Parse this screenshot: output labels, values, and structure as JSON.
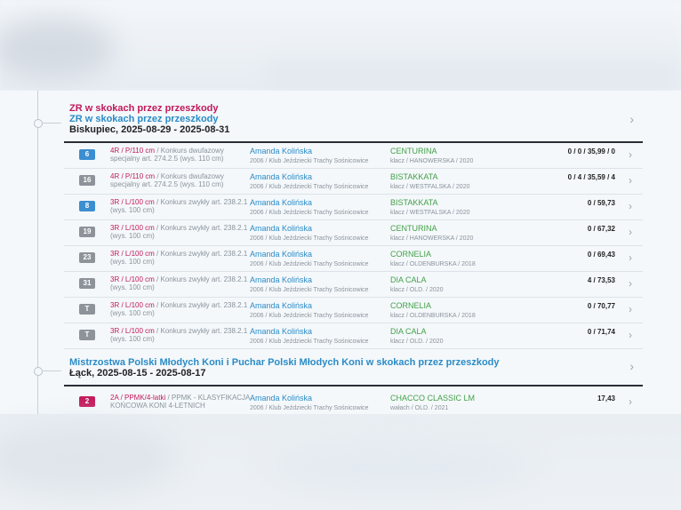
{
  "events": [
    {
      "title_primary": "ZR w skokach przez przeszkody",
      "title_secondary": "ZR w skokach przez przeszkody",
      "place_dates": "Biskupiec, 2025-08-29 - 2025-08-31",
      "rows": [
        {
          "badge": "6",
          "badge_color": "blue",
          "class": "4R / P/110 cm",
          "comp": " / Konkurs dwufazowy specjalny art. 274.2.5 (wys. 110 cm)",
          "rider": "Amanda Kolińska",
          "rider_sub": "2006 / Klub Jeździecki Trachy Sośnicowice",
          "horse": "CENTURINA",
          "horse_sub": "klacz / HANOWERSKA / 2020",
          "score": "0 / 0 / 35,99 / 0"
        },
        {
          "badge": "16",
          "badge_color": "grey",
          "class": "4R / P/110 cm",
          "comp": " / Konkurs dwufazowy specjalny art. 274.2.5 (wys. 110 cm)",
          "rider": "Amanda Kolińska",
          "rider_sub": "2006 / Klub Jeździecki Trachy Sośnicowice",
          "horse": "BISTAKKATA",
          "horse_sub": "klacz / WESTFALSKA / 2020",
          "score": "0 / 4 / 35,59 / 4"
        },
        {
          "badge": "8",
          "badge_color": "blue",
          "class": "3R / L/100 cm",
          "comp": " / Konkurs zwykły art. 238.2.1 (wys. 100 cm)",
          "rider": "Amanda Kolińska",
          "rider_sub": "2006 / Klub Jeździecki Trachy Sośnicowice",
          "horse": "BISTAKKATA",
          "horse_sub": "klacz / WESTFALSKA / 2020",
          "score": "0 / 59,73"
        },
        {
          "badge": "19",
          "badge_color": "grey",
          "class": "3R / L/100 cm",
          "comp": " / Konkurs zwykły art. 238.2.1 (wys. 100 cm)",
          "rider": "Amanda Kolińska",
          "rider_sub": "2006 / Klub Jeździecki Trachy Sośnicowice",
          "horse": "CENTURINA",
          "horse_sub": "klacz / HANOWERSKA / 2020",
          "score": "0 / 67,32"
        },
        {
          "badge": "23",
          "badge_color": "grey",
          "class": "3R / L/100 cm",
          "comp": " / Konkurs zwykły art. 238.2.1 (wys. 100 cm)",
          "rider": "Amanda Kolińska",
          "rider_sub": "2006 / Klub Jeździecki Trachy Sośnicowice",
          "horse": "CORNELIA",
          "horse_sub": "klacz / OLDENBURSKA / 2018",
          "score": "0 / 69,43"
        },
        {
          "badge": "31",
          "badge_color": "grey",
          "class": "3R / L/100 cm",
          "comp": " / Konkurs zwykły art. 238.2.1 (wys. 100 cm)",
          "rider": "Amanda Kolińska",
          "rider_sub": "2006 / Klub Jeździecki Trachy Sośnicowice",
          "horse": "DIA CALA",
          "horse_sub": "klacz / OLD. / 2020",
          "score": "4 / 73,53"
        },
        {
          "badge": "T",
          "badge_color": "grey",
          "class": "3R / L/100 cm",
          "comp": " / Konkurs zwykły art. 238.2.1 (wys. 100 cm)",
          "rider": "Amanda Kolińska",
          "rider_sub": "2006 / Klub Jeździecki Trachy Sośnicowice",
          "horse": "CORNELIA",
          "horse_sub": "klacz / OLDENBURSKA / 2018",
          "score": "0 / 70,77"
        },
        {
          "badge": "T",
          "badge_color": "grey",
          "class": "3R / L/100 cm",
          "comp": " / Konkurs zwykły art. 238.2.1 (wys. 100 cm)",
          "rider": "Amanda Kolińska",
          "rider_sub": "2006 / Klub Jeździecki Trachy Sośnicowice",
          "horse": "DIA CALA",
          "horse_sub": "klacz / OLD. / 2020",
          "score": "0 / 71,74"
        }
      ]
    },
    {
      "title_primary": "",
      "title_secondary": "Mistrzostwa Polski Młodych Koni i Puchar Polski Młodych Koni w skokach przez przeszkody",
      "place_dates": "Łąck, 2025-08-15 - 2025-08-17",
      "rows": [
        {
          "badge": "2",
          "badge_color": "pink",
          "class": "2A / PPMK/4-latki",
          "comp": " / PPMK - KLASYFIKACJA KOŃCOWA KONI 4-LETNICH",
          "rider": "Amanda Kolińska",
          "rider_sub": "2006 / Klub Jeździecki Trachy Sośnicowice",
          "horse": "CHACCO CLASSIC LM",
          "horse_sub": "wałach / OLD. / 2021",
          "score": "17,43"
        }
      ]
    }
  ],
  "colors": {
    "badge_blue": "#3b8ed0",
    "badge_grey": "#8d9399",
    "badge_pink": "#c2185b"
  },
  "icons": {
    "row_action": "chevron-right-icon"
  }
}
